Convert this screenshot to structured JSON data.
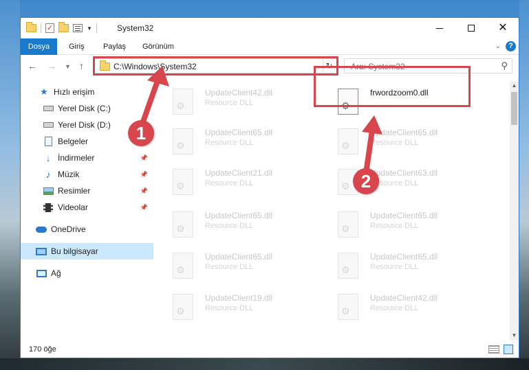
{
  "window": {
    "title": "System32",
    "controls": {
      "minimize": "minimize",
      "maximize": "maximize",
      "close": "✕"
    }
  },
  "ribbon": {
    "tabs": [
      "Dosya",
      "Giriş",
      "Paylaş",
      "Görünüm"
    ],
    "help": "?"
  },
  "navigation": {
    "address": "C:\\Windows\\System32",
    "search_placeholder": "Ara: System32"
  },
  "sidebar": {
    "items": [
      {
        "label": "Hızlı erişim",
        "icon": "star-icon"
      },
      {
        "label": "Yerel Disk (C:)",
        "icon": "disk-icon"
      },
      {
        "label": "Yerel Disk (D:)",
        "icon": "disk-icon"
      },
      {
        "label": "Belgeler",
        "icon": "document-icon"
      },
      {
        "label": "İndirmeler",
        "icon": "download-icon",
        "pinned": true
      },
      {
        "label": "Müzik",
        "icon": "music-icon",
        "pinned": true
      },
      {
        "label": "Resimler",
        "icon": "pictures-icon",
        "pinned": true
      },
      {
        "label": "Videolar",
        "icon": "video-icon",
        "pinned": true
      },
      {
        "label": "OneDrive",
        "icon": "cloud-icon"
      },
      {
        "label": "Bu bilgisayar",
        "icon": "computer-icon",
        "selected": true
      },
      {
        "label": "Ağ",
        "icon": "network-icon"
      }
    ]
  },
  "files": [
    {
      "name": "UpdateClient42.dll",
      "type": "Resource DLL"
    },
    {
      "name": "frwordzoom0.dll",
      "type": ""
    },
    {
      "name": "UpdateClient65.dll",
      "type": "Resource DLL"
    },
    {
      "name": "UpdateClient65.dll",
      "type": "Resource DLL"
    },
    {
      "name": "UpdateClient21.dll",
      "type": "Resource DLL"
    },
    {
      "name": "UpdateClient63.dll",
      "type": "Resource DLL"
    },
    {
      "name": "UpdateClient65.dll",
      "type": "Resource DLL"
    },
    {
      "name": "UpdateClient65.dll",
      "type": "Resource DLL"
    },
    {
      "name": "UpdateClient65.dll",
      "type": "Resource DLL"
    },
    {
      "name": "UpdateClient65.dll",
      "type": "Resource DLL"
    },
    {
      "name": "UpdateClient19.dll",
      "type": "Resource DLL"
    },
    {
      "name": "UpdateClient42.dll",
      "type": "Resource DLL"
    }
  ],
  "status": {
    "item_count": "170 öğe"
  },
  "callouts": [
    "1",
    "2"
  ],
  "colors": {
    "accent": "#1979ca",
    "highlight": "#d9454d",
    "selection": "#cce8ff"
  }
}
